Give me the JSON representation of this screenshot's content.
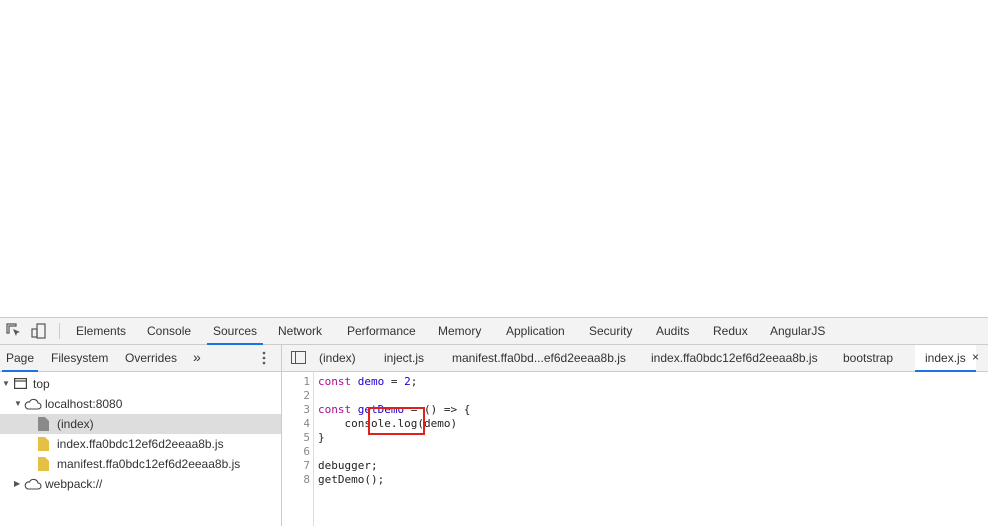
{
  "main_tabs": [
    "Elements",
    "Console",
    "Sources",
    "Network",
    "Performance",
    "Memory",
    "Application",
    "Security",
    "Audits",
    "Redux",
    "AngularJS"
  ],
  "active_main_tab": "Sources",
  "nav_tabs": [
    "Page",
    "Filesystem",
    "Overrides"
  ],
  "nav_more": "»",
  "tree": {
    "top": "top",
    "host": "localhost:8080",
    "files": [
      "(index)",
      "index.ffa0bdc12ef6d2eeaa8b.js",
      "manifest.ffa0bdc12ef6d2eeaa8b.js"
    ],
    "webpack": "webpack://"
  },
  "editor_tabs": [
    "(index)",
    "inject.js",
    "manifest.ffa0bd...ef6d2eeaa8b.js",
    "index.ffa0bdc12ef6d2eeaa8b.js",
    "bootstrap",
    "index.js"
  ],
  "editor_close": "×",
  "line_numbers": [
    "1",
    "2",
    "3",
    "4",
    "5",
    "6",
    "7",
    "8"
  ],
  "code": {
    "l1_kw": "const",
    "l1_var": "demo",
    "l1_rest": " = ",
    "l1_num": "2",
    "l1_end": ";",
    "l3_kw": "const",
    "l3_var": "getDemo",
    "l3_rest": " = () => {",
    "l4": "    console.log(demo)",
    "l5": "}",
    "l7": "debugger;",
    "l8": "getDemo();"
  }
}
